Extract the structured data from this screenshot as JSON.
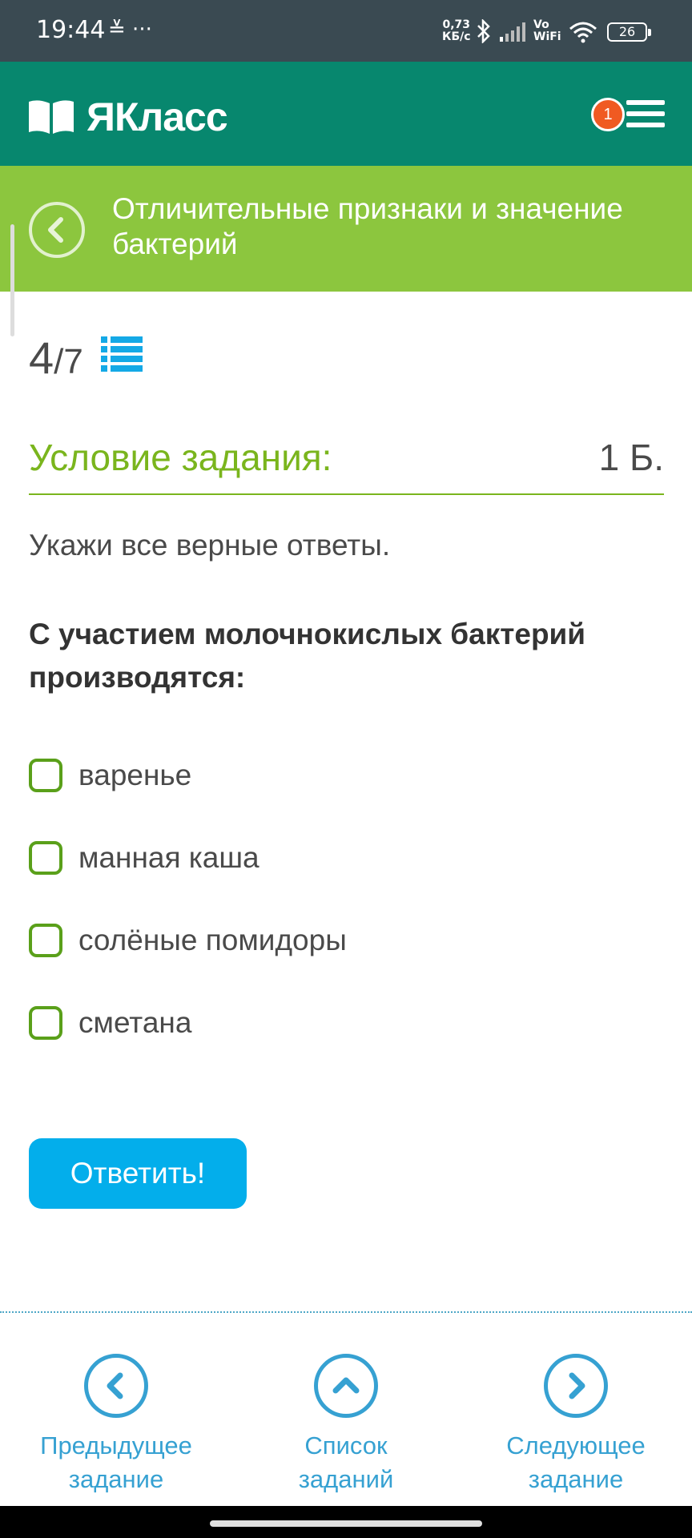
{
  "status_bar": {
    "time": "19:44",
    "left_icons": "≚ ···",
    "speed_value": "0,73",
    "speed_unit": "КБ/с",
    "vowifi_top": "Vo",
    "vowifi_bottom": "WiFi",
    "battery": "26"
  },
  "header": {
    "logo_text": "ЯКласс",
    "menu_badge": "1"
  },
  "topic": {
    "title": "Отличительные признаки и значение бактерий"
  },
  "progress": {
    "current": "4",
    "total": "/7"
  },
  "task": {
    "condition_label": "Условие задания:",
    "points": "1 Б.",
    "instruction": "Укажи все верные ответы.",
    "question": "С участием молочнокислых бактерий производятся:",
    "options": [
      {
        "label": "варенье",
        "checked": false
      },
      {
        "label": "манная каша",
        "checked": false
      },
      {
        "label": "солёные помидоры",
        "checked": false
      },
      {
        "label": "сметана",
        "checked": false
      }
    ],
    "answer_button": "Ответить!"
  },
  "nav": {
    "prev_line1": "Предыдущее",
    "prev_line2": "задание",
    "list_line1": "Список",
    "list_line2": "заданий",
    "next_line1": "Следующее",
    "next_line2": "задание"
  },
  "colors": {
    "header": "#07876e",
    "topic_bar": "#8cc63e",
    "accent_green": "#7ab51d",
    "button_blue": "#03aeeb",
    "nav_blue": "#36a1d2",
    "badge_orange": "#f05a22"
  }
}
